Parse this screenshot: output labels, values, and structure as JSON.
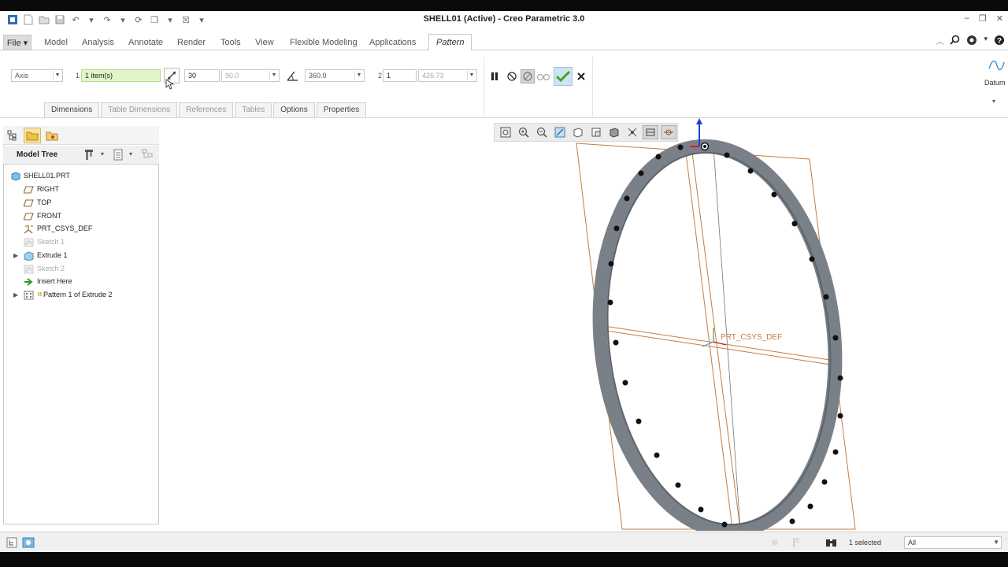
{
  "window": {
    "title": "SHELL01 (Active) - Creo Parametric 3.0"
  },
  "menu_tabs": [
    {
      "label": "File ▾",
      "name": "tab-file"
    },
    {
      "label": "Model",
      "name": "tab-model"
    },
    {
      "label": "Analysis",
      "name": "tab-analysis"
    },
    {
      "label": "Annotate",
      "name": "tab-annotate"
    },
    {
      "label": "Render",
      "name": "tab-render"
    },
    {
      "label": "Tools",
      "name": "tab-tools"
    },
    {
      "label": "View",
      "name": "tab-view"
    },
    {
      "label": "Flexible Modeling",
      "name": "tab-flexible-modeling"
    },
    {
      "label": "Applications",
      "name": "tab-applications"
    },
    {
      "label": "Pattern",
      "name": "tab-pattern"
    }
  ],
  "pattern": {
    "type_value": "Axis",
    "first_dir_label": "1",
    "reference_value": "1 item(s)",
    "member_count": "30",
    "member_spacing": "90.0",
    "angular_extent": "360.0",
    "second_dir_label": "2",
    "second_count": "1",
    "second_spacing": "426.73"
  },
  "sub_tabs": [
    {
      "label": "Dimensions",
      "enabled": true
    },
    {
      "label": "Table Dimensions",
      "enabled": false
    },
    {
      "label": "References",
      "enabled": false
    },
    {
      "label": "Tables",
      "enabled": false
    },
    {
      "label": "Options",
      "enabled": true
    },
    {
      "label": "Properties",
      "enabled": true
    }
  ],
  "datum_label": "Datum",
  "model_tree": {
    "title": "Model Tree",
    "items": [
      {
        "label": "SHELL01.PRT",
        "icon": "part-icon",
        "enabled": true,
        "indent": 0
      },
      {
        "label": "RIGHT",
        "icon": "datum-plane-icon",
        "enabled": true,
        "indent": 1
      },
      {
        "label": "TOP",
        "icon": "datum-plane-icon",
        "enabled": true,
        "indent": 1
      },
      {
        "label": "FRONT",
        "icon": "datum-plane-icon",
        "enabled": true,
        "indent": 1
      },
      {
        "label": "PRT_CSYS_DEF",
        "icon": "csys-icon",
        "enabled": true,
        "indent": 1
      },
      {
        "label": "Sketch 1",
        "icon": "sketch-icon",
        "enabled": false,
        "indent": 1
      },
      {
        "label": "Extrude 1",
        "icon": "extrude-icon",
        "enabled": true,
        "indent": 1,
        "expandable": true
      },
      {
        "label": "Sketch 2",
        "icon": "sketch-icon",
        "enabled": false,
        "indent": 1
      },
      {
        "label": "Insert Here",
        "icon": "insert-arrow-icon",
        "enabled": true,
        "indent": 1
      },
      {
        "label": "Pattern 1 of Extrude 2",
        "icon": "pattern-icon",
        "enabled": true,
        "indent": 1,
        "expandable": true
      }
    ]
  },
  "canvas": {
    "csys_label": "PRT_CSYS_DEF",
    "hole_count": 30
  },
  "status": {
    "selected": "1 selected",
    "filter": "All"
  },
  "colors": {
    "accent_green": "#4caf2a",
    "ring": "#7a8088",
    "bbox": "#c87b3c",
    "hole": "#111111"
  }
}
